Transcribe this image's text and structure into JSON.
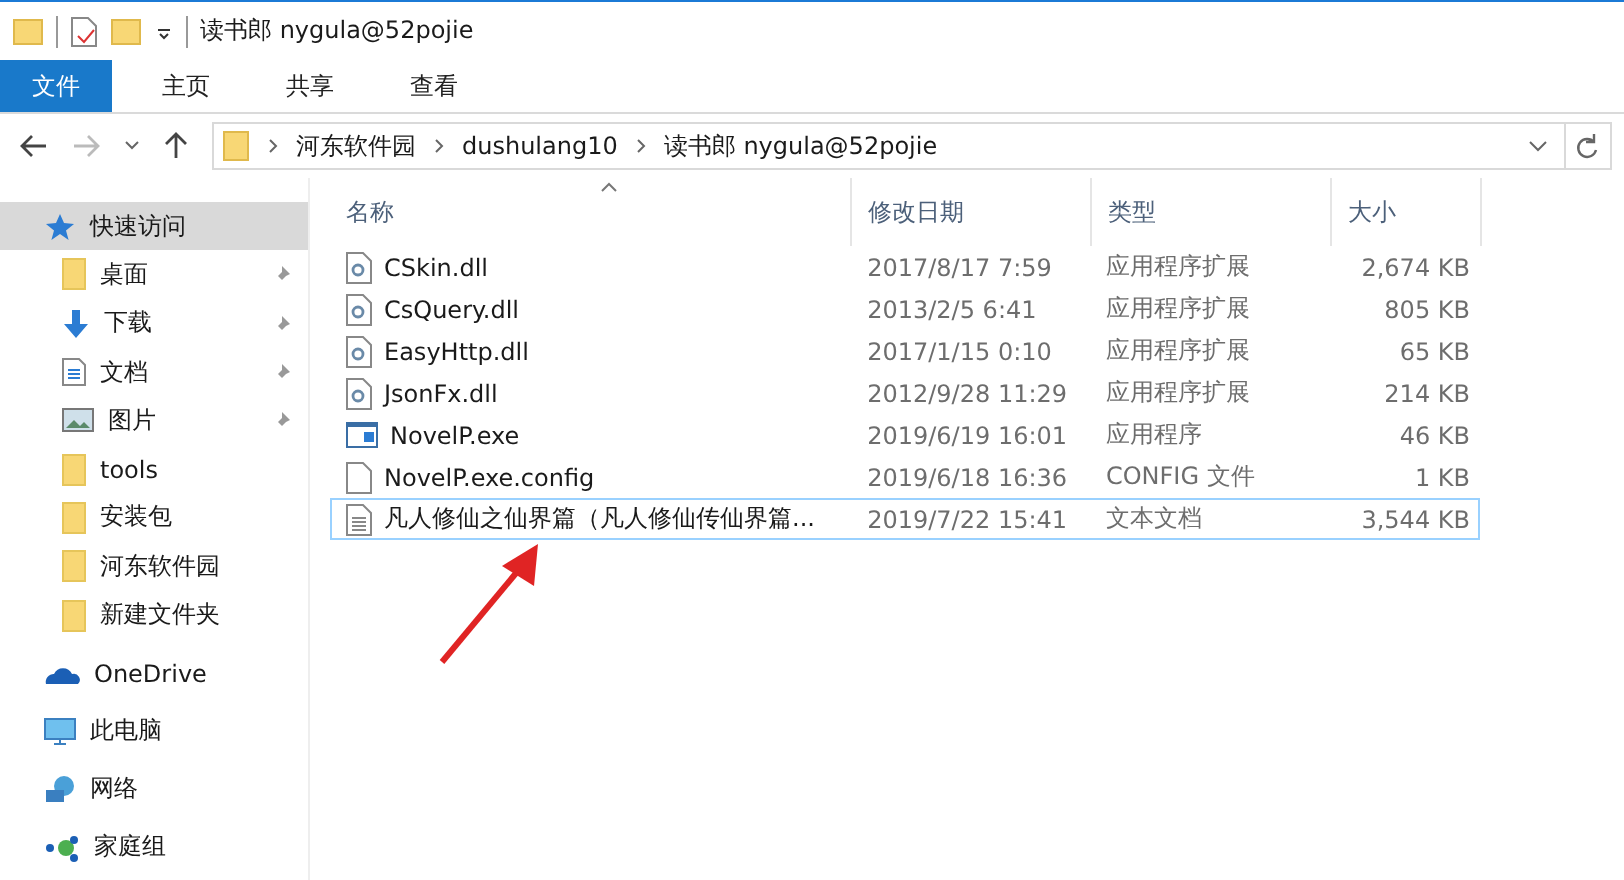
{
  "title_bar": {
    "title": "读书郎 nygula@52pojie"
  },
  "ribbon_tabs": [
    {
      "label": "文件",
      "kind": "file"
    },
    {
      "label": "主页",
      "kind": "tab"
    },
    {
      "label": "共享",
      "kind": "tab"
    },
    {
      "label": "查看",
      "kind": "tab"
    }
  ],
  "address_bar": {
    "path": [
      "河东软件园",
      "dushulang10",
      "读书郎 nygula@52pojie"
    ]
  },
  "sidebar": {
    "items": [
      {
        "label": "快速访问",
        "kind": "star",
        "selected": true,
        "pinned": false,
        "indent": false
      },
      {
        "label": "桌面",
        "kind": "folder",
        "selected": false,
        "pinned": true,
        "indent": true
      },
      {
        "label": "下载",
        "kind": "download",
        "selected": false,
        "pinned": true,
        "indent": true
      },
      {
        "label": "文档",
        "kind": "document",
        "selected": false,
        "pinned": true,
        "indent": true
      },
      {
        "label": "图片",
        "kind": "picture",
        "selected": false,
        "pinned": true,
        "indent": true
      },
      {
        "label": "tools",
        "kind": "folder",
        "selected": false,
        "pinned": false,
        "indent": true
      },
      {
        "label": "安装包",
        "kind": "folder",
        "selected": false,
        "pinned": false,
        "indent": true
      },
      {
        "label": "河东软件园",
        "kind": "folder",
        "selected": false,
        "pinned": false,
        "indent": true
      },
      {
        "label": "新建文件夹",
        "kind": "folder",
        "selected": false,
        "pinned": false,
        "indent": true
      },
      {
        "label": "OneDrive",
        "kind": "cloud",
        "selected": false,
        "pinned": false,
        "indent": false
      },
      {
        "label": "此电脑",
        "kind": "pc",
        "selected": false,
        "pinned": false,
        "indent": false
      },
      {
        "label": "网络",
        "kind": "network",
        "selected": false,
        "pinned": false,
        "indent": false
      },
      {
        "label": "家庭组",
        "kind": "homegroup",
        "selected": false,
        "pinned": false,
        "indent": false
      }
    ]
  },
  "table": {
    "columns": [
      "名称",
      "修改日期",
      "类型",
      "大小"
    ],
    "rows": [
      {
        "name": "CSkin.dll",
        "date": "2017/8/17 7:59",
        "type": "应用程序扩展",
        "size": "2,674 KB",
        "kind": "dll",
        "focused": false
      },
      {
        "name": "CsQuery.dll",
        "date": "2013/2/5 6:41",
        "type": "应用程序扩展",
        "size": "805 KB",
        "kind": "dll",
        "focused": false
      },
      {
        "name": "EasyHttp.dll",
        "date": "2017/1/15 0:10",
        "type": "应用程序扩展",
        "size": "65 KB",
        "kind": "dll",
        "focused": false
      },
      {
        "name": "JsonFx.dll",
        "date": "2012/9/28 11:29",
        "type": "应用程序扩展",
        "size": "214 KB",
        "kind": "dll",
        "focused": false
      },
      {
        "name": "NovelP.exe",
        "date": "2019/6/19 16:01",
        "type": "应用程序",
        "size": "46 KB",
        "kind": "exe",
        "focused": false
      },
      {
        "name": "NovelP.exe.config",
        "date": "2019/6/18 16:36",
        "type": "CONFIG 文件",
        "size": "1 KB",
        "kind": "config",
        "focused": false
      },
      {
        "name": "凡人修仙之仙界篇（凡人修仙传仙界篇...",
        "date": "2019/7/22 15:41",
        "type": "文本文档",
        "size": "3,544 KB",
        "kind": "txt",
        "focused": true
      }
    ]
  }
}
